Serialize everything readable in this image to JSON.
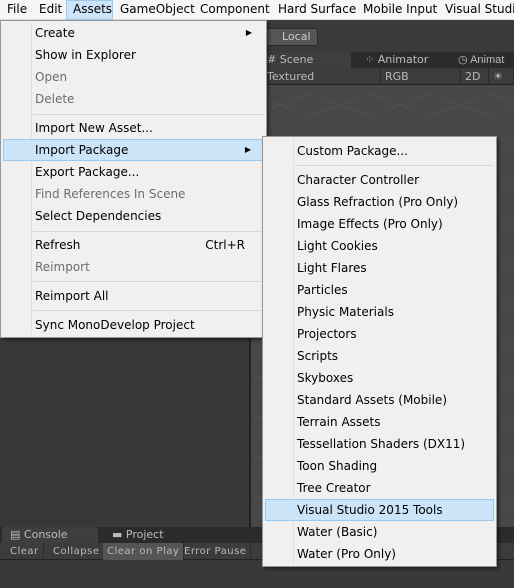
{
  "menubar": [
    "File",
    "Edit",
    "Assets",
    "GameObject",
    "Component",
    "Hard Surface",
    "Mobile Input",
    "Visual Studio"
  ],
  "active_menu": "Assets",
  "editor": {
    "local_button": "Local",
    "tabs": [
      "Scene",
      "Animator",
      "Animat"
    ],
    "scene_options": [
      "Textured",
      "RGB",
      "2D"
    ],
    "console_tabs": [
      "Console",
      "Project"
    ],
    "console_buttons": [
      "Clear",
      "Collapse",
      "Clear on Play",
      "Error Pause"
    ],
    "active_console_button": "Clear on Play"
  },
  "assets_menu": [
    {
      "label": "Create",
      "submenu": true
    },
    {
      "label": "Show in Explorer"
    },
    {
      "label": "Open",
      "disabled": true
    },
    {
      "label": "Delete",
      "disabled": true
    },
    {
      "label": "Import New Asset..."
    },
    {
      "label": "Import Package",
      "submenu": true,
      "highlighted": true
    },
    {
      "label": "Export Package..."
    },
    {
      "label": "Find References In Scene",
      "disabled": true
    },
    {
      "label": "Select Dependencies"
    },
    {
      "label": "Refresh",
      "shortcut": "Ctrl+R"
    },
    {
      "label": "Reimport",
      "disabled": true
    },
    {
      "label": "Reimport All"
    },
    {
      "label": "Sync MonoDevelop Project"
    }
  ],
  "import_package_menu": [
    "Custom Package...",
    "Character Controller",
    "Glass Refraction (Pro Only)",
    "Image Effects (Pro Only)",
    "Light Cookies",
    "Light Flares",
    "Particles",
    "Physic Materials",
    "Projectors",
    "Scripts",
    "Skyboxes",
    "Standard Assets (Mobile)",
    "Terrain Assets",
    "Tessellation Shaders (DX11)",
    "Toon Shading",
    "Tree Creator",
    "Visual Studio 2015 Tools",
    "Water (Basic)",
    "Water (Pro Only)"
  ],
  "highlighted_import_item": "Visual Studio 2015 Tools"
}
